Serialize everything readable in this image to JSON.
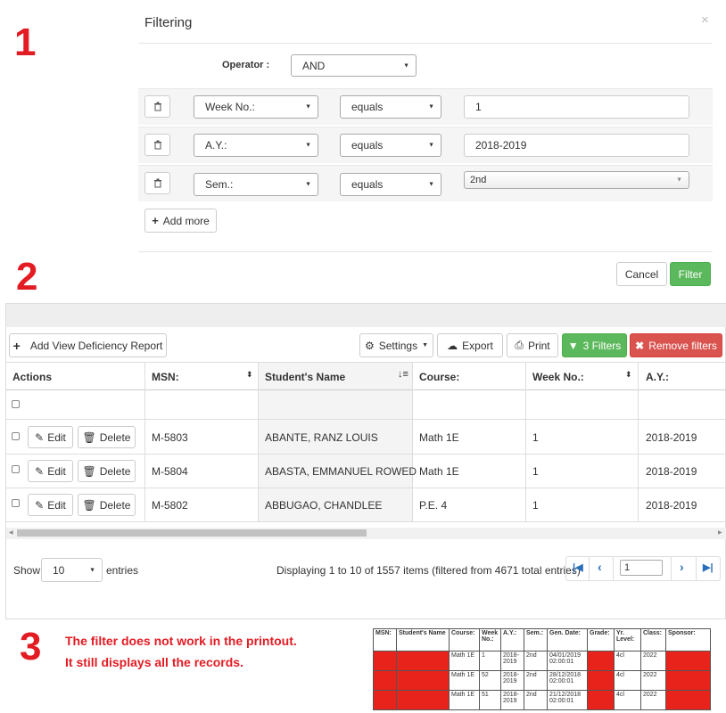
{
  "annotations": {
    "n1": "1",
    "n2": "2",
    "n3": "3",
    "note_line1": "The filter does not work in the printout.",
    "note_line2": "It still displays all the records."
  },
  "filter_dialog": {
    "title": "Filtering",
    "close": "×",
    "operator_label": "Operator :",
    "operator_value": "AND",
    "rows": [
      {
        "field": "Week No.:",
        "cond": "equals",
        "value": "1"
      },
      {
        "field": "A.Y.:",
        "cond": "equals",
        "value": "2018-2019"
      },
      {
        "field": "Sem.:",
        "cond": "equals",
        "value": "2nd"
      }
    ],
    "add_more": "Add more",
    "cancel": "Cancel",
    "filter": "Filter"
  },
  "grid": {
    "toolbar": {
      "add": "Add View Deficiency Report",
      "settings": "Settings",
      "export": "Export",
      "print": "Print",
      "filters": "3 Filters",
      "remove": "Remove filters"
    },
    "columns": [
      "Actions",
      "MSN:",
      "Student's Name",
      "Course:",
      "Week No.:",
      "A.Y.:"
    ],
    "edit": "Edit",
    "delete": "Delete",
    "rows": [
      {
        "msn": "M-5803",
        "name": "ABANTE, RANZ LOUIS",
        "course": "Math 1E",
        "week": "1",
        "ay": "2018-2019"
      },
      {
        "msn": "M-5804",
        "name": "ABASTA, EMMANUEL ROWED",
        "course": "Math 1E",
        "week": "1",
        "ay": "2018-2019"
      },
      {
        "msn": "M-5802",
        "name": "ABBUGAO, CHANDLEE",
        "course": "P.E. 4",
        "week": "1",
        "ay": "2018-2019"
      }
    ],
    "footer": {
      "show": "Show",
      "entries_value": "10",
      "entries": "entries",
      "info": "Displaying 1 to 10 of 1557 items (filtered from 4671 total entries)",
      "page": "1"
    }
  },
  "printout": {
    "headers": [
      "MSN:",
      "Student's Name",
      "Course:",
      "Week No.:",
      "A.Y.:",
      "Sem.:",
      "Gen. Date:",
      "Grade:",
      "Yr. Level:",
      "Class:",
      "Sponsor:"
    ],
    "rows": [
      {
        "course": "Math 1E",
        "week": "1",
        "ay": "2018-2019",
        "sem": "2nd",
        "date": "04/01/2019 02:00:01",
        "yr": "4cl",
        "cls": "2022"
      },
      {
        "course": "Math 1E",
        "week": "52",
        "ay": "2018-2019",
        "sem": "2nd",
        "date": "28/12/2018 02:00:01",
        "yr": "4cl",
        "cls": "2022"
      },
      {
        "course": "Math 1E",
        "week": "51",
        "ay": "2018-2019",
        "sem": "2nd",
        "date": "21/12/2018 02:00:01",
        "yr": "4cl",
        "cls": "2022"
      }
    ]
  }
}
